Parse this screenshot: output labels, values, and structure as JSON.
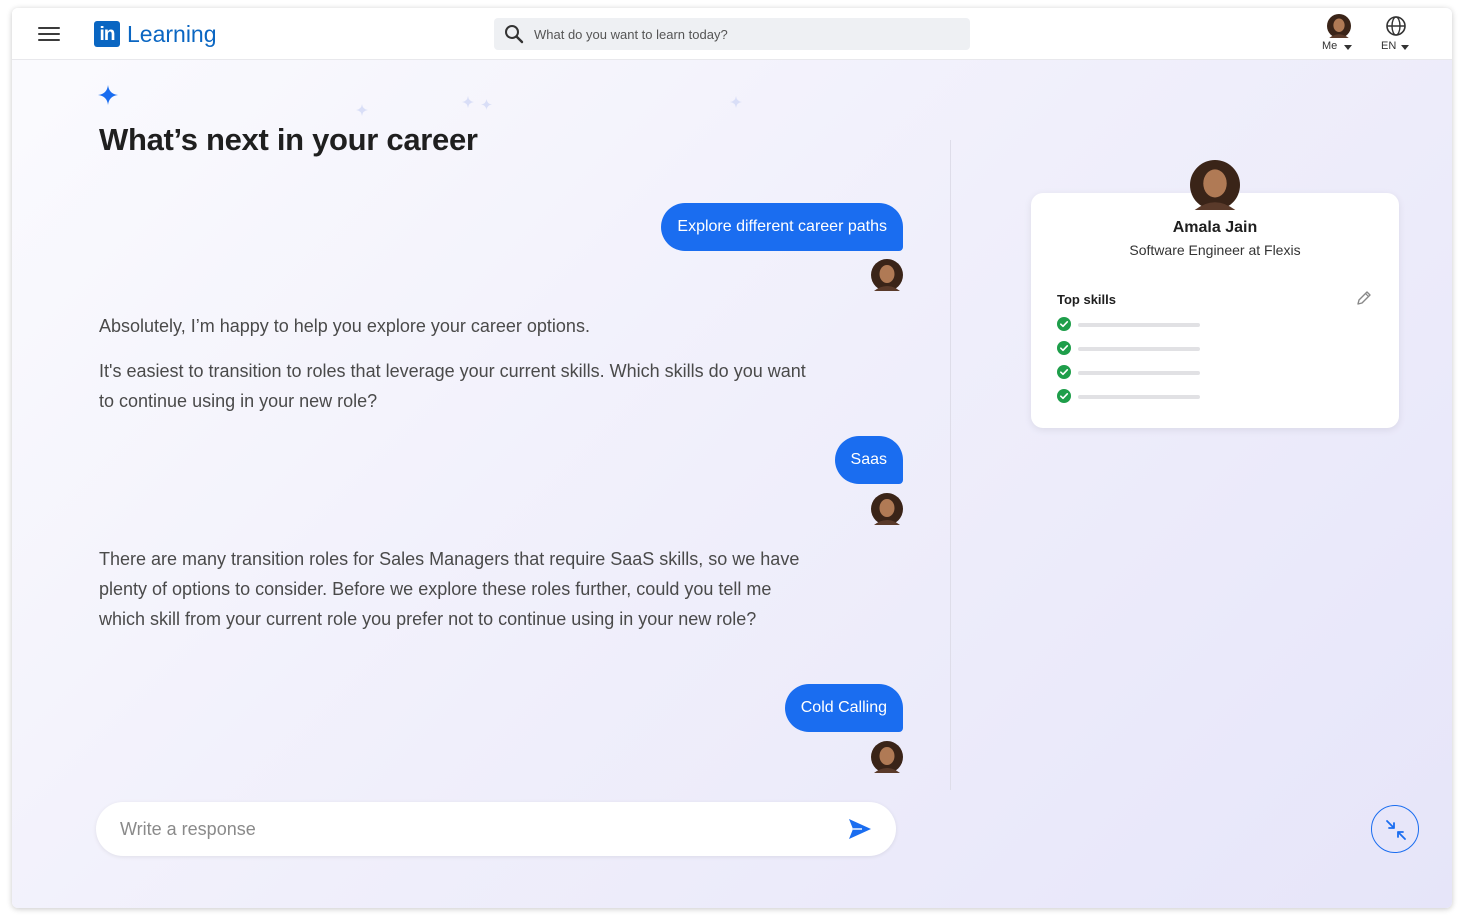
{
  "header": {
    "logo_mark": "in",
    "logo_text": "Learning",
    "search_placeholder": "What do you want to learn today?",
    "me_label": "Me",
    "lang_label": "EN",
    "icons": [
      "menu-icon",
      "search-icon",
      "globe-icon",
      "caret-down-icon"
    ]
  },
  "main": {
    "title": "What’s next in your career",
    "messages": [
      {
        "role": "user",
        "text": "Explore different career paths"
      },
      {
        "role": "assistant",
        "paragraphs": [
          "Absolutely, I’m happy to help you explore your career options.",
          "It's easiest to transition to roles that leverage your current skills. Which skills do you want to continue using in your new role?"
        ]
      },
      {
        "role": "user",
        "text": "Saas"
      },
      {
        "role": "assistant",
        "paragraphs": [
          "There are many transition roles for Sales Managers that require SaaS skills, so we have plenty of options to consider. Before we explore these roles further, could you tell me which skill from your current role you prefer not to continue using in your new role?"
        ]
      },
      {
        "role": "user",
        "text": "Cold Calling"
      }
    ],
    "response_placeholder": "Write a response"
  },
  "profile": {
    "name": "Amala Jain",
    "role": "Software Engineer at Flexis",
    "skills_title": "Top skills",
    "skills_count": 4
  },
  "colors": {
    "accent": "#1a6df0",
    "brand": "#0a66c2",
    "check": "#1e9e4a"
  }
}
